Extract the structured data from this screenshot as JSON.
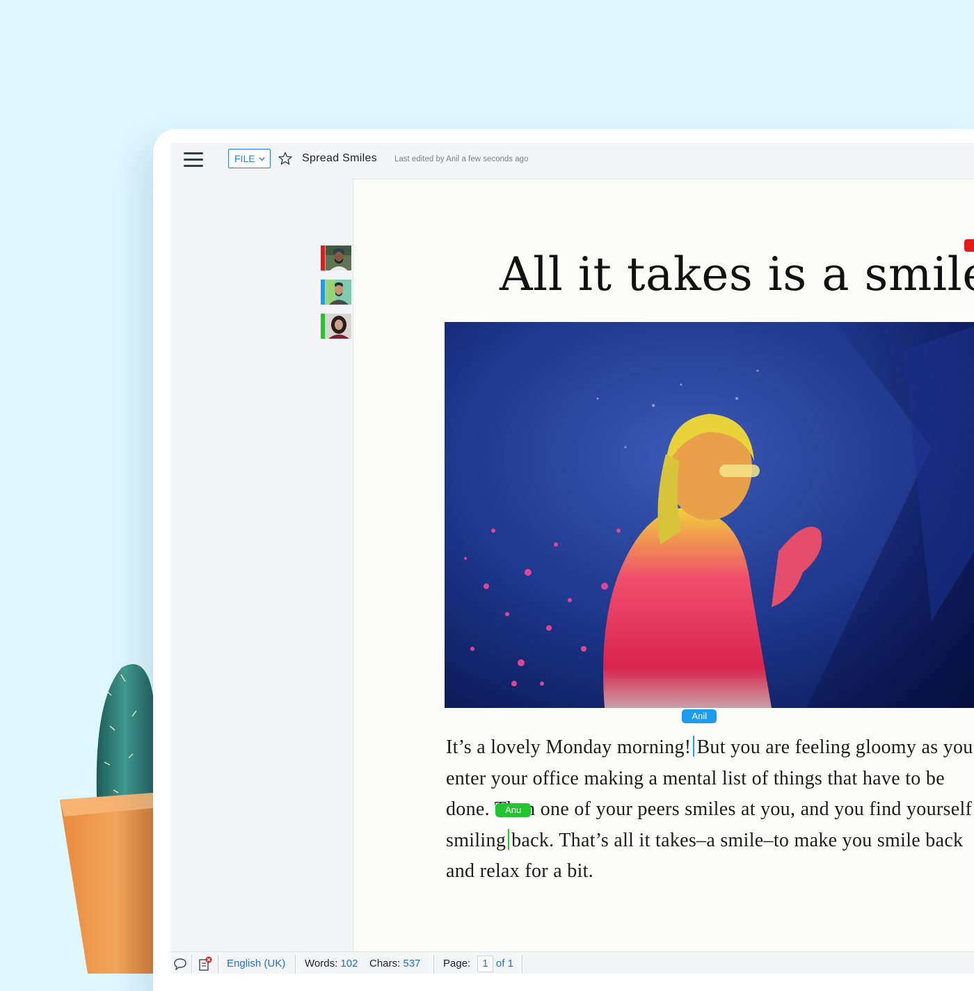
{
  "toolbar": {
    "file_label": "FILE",
    "doc_title": "Spread Smiles",
    "last_edited": "Last edited by Anil a few seconds ago"
  },
  "collaborators": [
    {
      "color": "#e21c1c"
    },
    {
      "color": "#1e9cf0"
    },
    {
      "color": "#22c52f"
    }
  ],
  "document": {
    "heading": "All it takes is a smile",
    "lines": [
      {
        "before": "It’s a lovely Monday morning!",
        "after": "But you are feeling gloomy as you"
      },
      {
        "text": "enter your office making a mental list of things that have to be"
      },
      {
        "text": "done. Then one of your peers smiles at you, and you find yourself"
      },
      {
        "before": "smiling",
        "after": "back. That’s all it takes–a smile–to make you smile back"
      },
      {
        "text": "and relax for a bit."
      }
    ],
    "cursors": {
      "anil": "Anil",
      "anu": "Anu"
    }
  },
  "status": {
    "language": "English (UK)",
    "words_label": "Words:",
    "words": "102",
    "chars_label": "Chars:",
    "chars": "537",
    "page_label": "Page:",
    "page_current": "1",
    "page_total": "of 1"
  }
}
